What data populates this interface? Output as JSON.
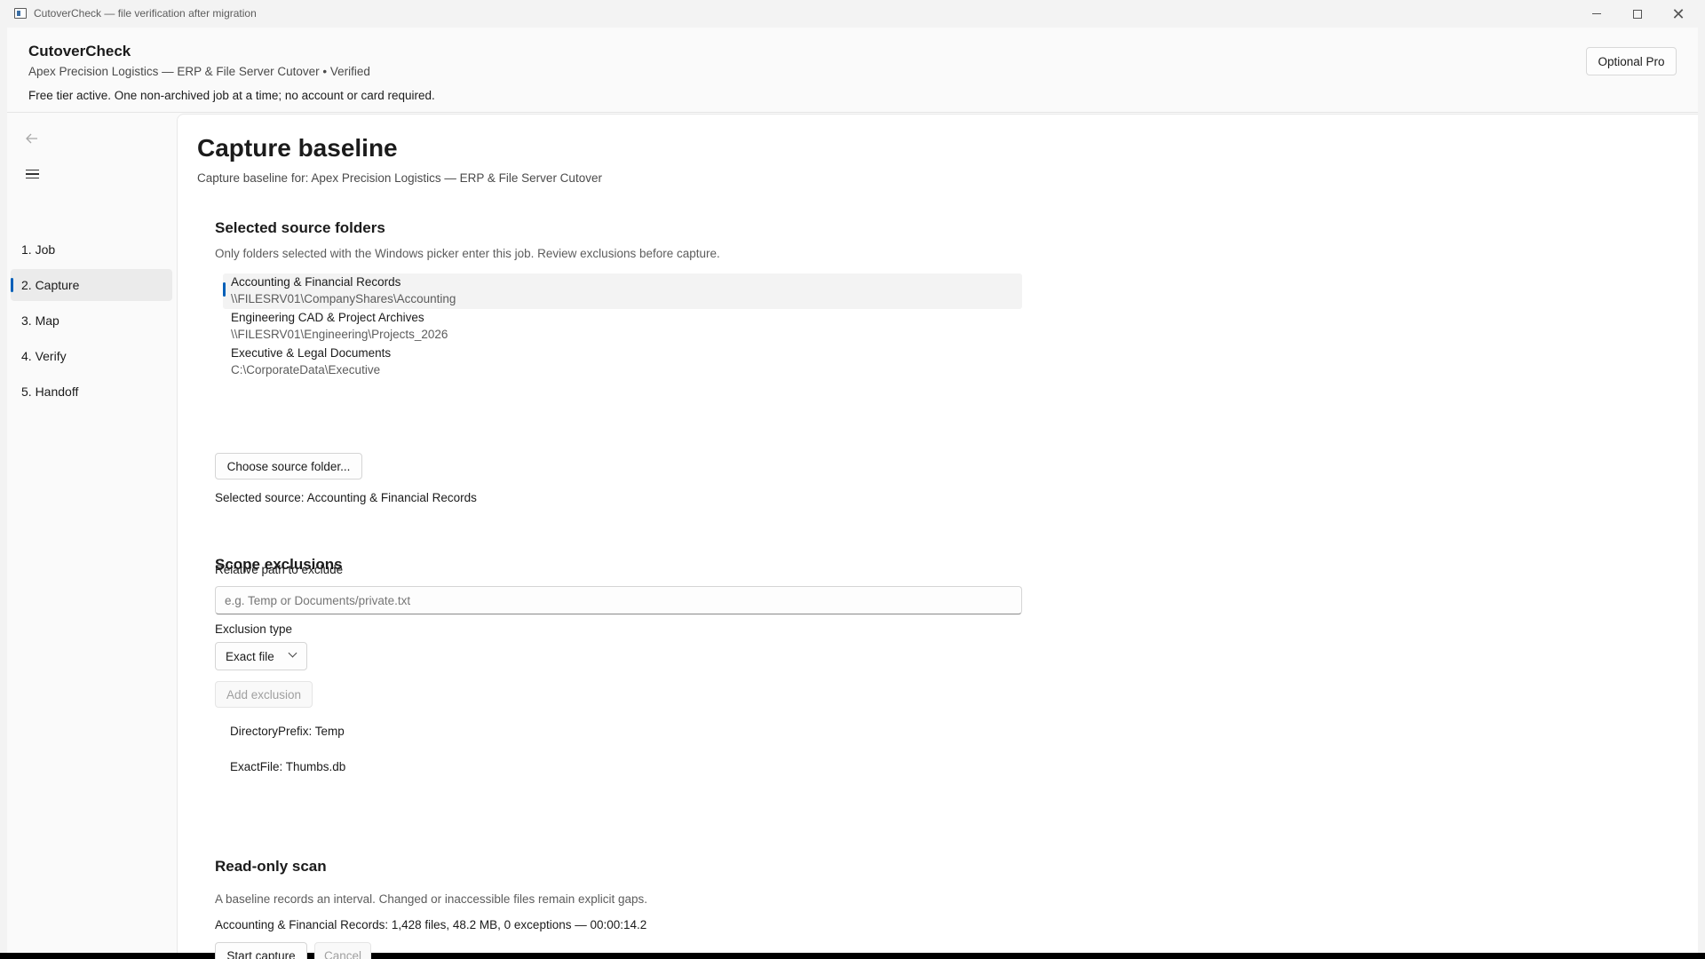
{
  "window": {
    "title": "CutoverCheck — file verification after migration"
  },
  "header": {
    "app_name": "CutoverCheck",
    "job_line": "Apex Precision Logistics — ERP & File Server Cutover  •  Verified",
    "tier_line": "Free tier active. One non-archived job at a time; no account or card required.",
    "pro_button": "Optional Pro"
  },
  "nav": {
    "items": [
      {
        "label": "1. Job",
        "selected": false
      },
      {
        "label": "2. Capture",
        "selected": true
      },
      {
        "label": "3. Map",
        "selected": false
      },
      {
        "label": "4. Verify",
        "selected": false
      },
      {
        "label": "5. Handoff",
        "selected": false
      }
    ]
  },
  "page": {
    "title": "Capture baseline",
    "subtitle": "Capture baseline for: Apex Precision Logistics — ERP & File Server Cutover"
  },
  "sources": {
    "title": "Selected source folders",
    "description": "Only folders selected with the Windows picker enter this job. Review exclusions before capture.",
    "folders": [
      {
        "name": "Accounting & Financial Records",
        "path": "\\\\FILESRV01\\CompanyShares\\Accounting",
        "selected": true
      },
      {
        "name": "Engineering CAD & Project Archives",
        "path": "\\\\FILESRV01\\Engineering\\Projects_2026",
        "selected": false
      },
      {
        "name": "Executive & Legal Documents",
        "path": "C:\\CorporateData\\Executive",
        "selected": false
      }
    ],
    "choose_button": "Choose source folder...",
    "selected_source": "Selected source: Accounting & Financial Records"
  },
  "exclusions": {
    "title": "Scope exclusions",
    "path_label": "Relative path to exclude",
    "path_value": "",
    "path_placeholder": "e.g. Temp or Documents/private.txt",
    "type_label": "Exclusion type",
    "type_selected": "Exact file",
    "add_button": "Add exclusion",
    "items": [
      "DirectoryPrefix: Temp",
      "ExactFile: Thumbs.db"
    ]
  },
  "scan": {
    "title": "Read-only scan",
    "description": "A baseline records an interval. Changed or inaccessible files remain explicit gaps.",
    "result": "Accounting & Financial Records: 1,428 files, 48.2 MB, 0 exceptions — 00:00:14.2",
    "start_button": "Start capture",
    "cancel_button": "Cancel"
  },
  "colors": {
    "accent": "#005fb8",
    "window_bg": "#f3f3f3",
    "content_bg": "#ffffff"
  },
  "icons": {
    "back": "arrow-left-icon",
    "menu": "hamburger-icon",
    "dropdown": "chevron-down-icon"
  }
}
